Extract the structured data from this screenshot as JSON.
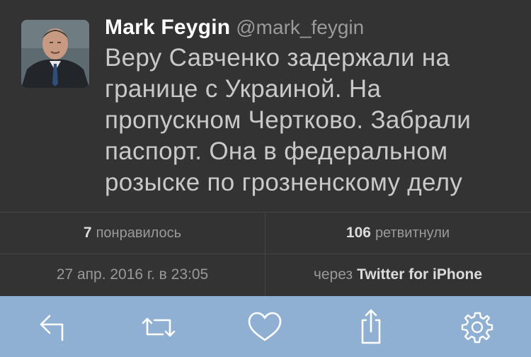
{
  "tweet": {
    "author_name": "Mark Feygin",
    "author_handle": "@mark_feygin",
    "text": "Веру Савченко задержали на границе с Украиной. На пропускном Чертково. Забрали паспорт. Она в федеральном розыске по грозненскому делу",
    "likes_count": "7",
    "likes_label": "понравилось",
    "retweets_count": "106",
    "retweets_label": "ретвитнули",
    "date": "27 апр. 2016 г. в 23:05",
    "via_prefix": "через",
    "via_app": "Twitter for iPhone"
  },
  "toolbar": {
    "icons": [
      "reply-icon",
      "retweet-icon",
      "like-icon",
      "share-icon",
      "settings-icon"
    ]
  },
  "colors": {
    "background": "#333333",
    "toolbar": "#8fb0d3",
    "icon": "#ffffff"
  }
}
